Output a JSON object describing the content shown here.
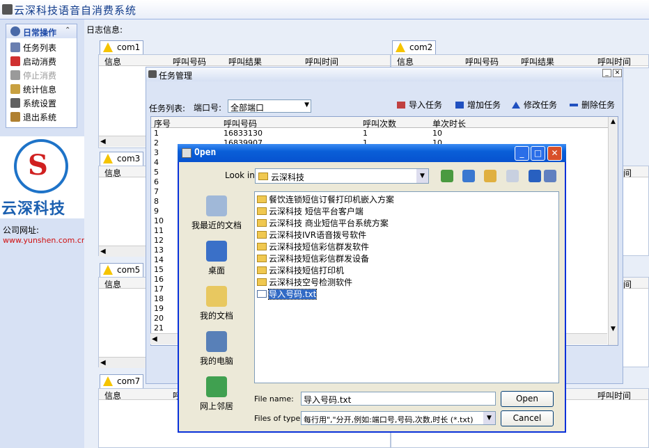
{
  "app": {
    "title": "云深科技语音自消费系统"
  },
  "sidebar": {
    "header": "日常操作",
    "items": [
      {
        "label": "任务列表",
        "color": "#6a7fb0"
      },
      {
        "label": "启动消费",
        "color": "#d03030"
      },
      {
        "label": "停止消费",
        "color": "#9a9a9a"
      },
      {
        "label": "统计信息",
        "color": "#c8a040"
      },
      {
        "label": "系统设置",
        "color": "#606060"
      },
      {
        "label": "退出系统",
        "color": "#b08030"
      }
    ]
  },
  "logo": {
    "text": "云深科技"
  },
  "company": {
    "label": "公司网址:",
    "url": "www.yunshen.com.cn"
  },
  "log": {
    "label": "日志信息:"
  },
  "ports": [
    {
      "tab": "com1",
      "headers": [
        "信息",
        "呼叫号码",
        "呼叫结果",
        "呼叫时间"
      ]
    },
    {
      "tab": "com2",
      "headers": [
        "信息",
        "呼叫号码",
        "呼叫结果",
        "呼叫时间"
      ]
    },
    {
      "tab": "com3",
      "headers": [
        "信息"
      ]
    },
    {
      "tab": "com5",
      "headers": [
        "信息"
      ]
    },
    {
      "tab": "com7",
      "headers": [
        "信息",
        "呼"
      ]
    }
  ],
  "right_partial": {
    "h1": "间",
    "h2": "间",
    "h3": "间",
    "h4": "呼叫时间"
  },
  "task": {
    "title": "任务管理",
    "list_label": "任务列表:",
    "port_label": "端口号:",
    "port_value": "全部端口",
    "buttons": [
      "导入任务",
      "增加任务",
      "修改任务",
      "删除任务"
    ],
    "columns": [
      "序号",
      "呼叫号码",
      "呼叫次数",
      "单次时长"
    ],
    "rows": [
      {
        "n": "1",
        "num": "16833130",
        "times": "1",
        "dur": "10"
      },
      {
        "n": "2",
        "num": "16839907",
        "times": "1",
        "dur": "10"
      },
      {
        "n": "3"
      },
      {
        "n": "4"
      },
      {
        "n": "5"
      },
      {
        "n": "6"
      },
      {
        "n": "7"
      },
      {
        "n": "8"
      },
      {
        "n": "9"
      },
      {
        "n": "10"
      },
      {
        "n": "11"
      },
      {
        "n": "12"
      },
      {
        "n": "13"
      },
      {
        "n": "14"
      },
      {
        "n": "15"
      },
      {
        "n": "16"
      },
      {
        "n": "17"
      },
      {
        "n": "18"
      },
      {
        "n": "19"
      },
      {
        "n": "20"
      },
      {
        "n": "21"
      }
    ]
  },
  "dialog": {
    "title": "Open",
    "look_in_label": "Look in:",
    "look_in_value": "云深科技",
    "places": [
      "我最近的文档",
      "桌面",
      "我的文档",
      "我的电脑",
      "网上邻居"
    ],
    "files": [
      "餐饮连锁短信订餐打印机嵌入方案",
      "云深科技 短信平台客户端",
      "云深科技 商业短信平台系统方案",
      "云深科技IVR语音拨号软件",
      "云深科技短信彩信群发软件",
      "云深科技短信彩信群发设备",
      "云深科技短信打印机",
      "云深科技空号检测软件",
      "导入号码.txt"
    ],
    "file_name_label": "File name:",
    "file_name_value": "导入号码.txt",
    "file_type_label": "Files of type:",
    "file_type_value": "每行用\",\"分开,例如:端口号,号码,次数,时长 (*.txt)",
    "open": "Open",
    "cancel": "Cancel"
  }
}
